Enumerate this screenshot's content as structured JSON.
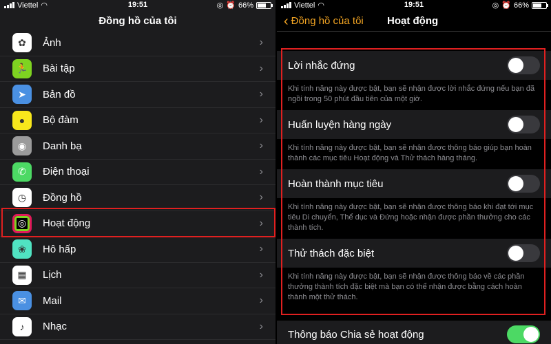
{
  "left": {
    "status": {
      "carrier": "Viettel",
      "time": "19:51",
      "battery": "66%",
      "battery_level": 0.66
    },
    "nav_title": "Đồng hồ của tôi",
    "items": [
      {
        "label": "Ảnh",
        "icon": "photos-icon",
        "color": "#ffffff"
      },
      {
        "label": "Bài tập",
        "icon": "workout-icon",
        "color": "#7ed321"
      },
      {
        "label": "Bản đồ",
        "icon": "maps-icon",
        "color": "#4a90e2"
      },
      {
        "label": "Bộ đàm",
        "icon": "walkie-talkie-icon",
        "color": "#f8e71c"
      },
      {
        "label": "Danh bạ",
        "icon": "contacts-icon",
        "color": "#9b9b9b"
      },
      {
        "label": "Điện thoại",
        "icon": "phone-icon",
        "color": "#4cd964"
      },
      {
        "label": "Đồng hồ",
        "icon": "clock-icon",
        "color": "#ffffff"
      },
      {
        "label": "Hoạt động",
        "icon": "activity-icon",
        "color": "#000000"
      },
      {
        "label": "Hô hấp",
        "icon": "breathe-icon",
        "color": "#50e3c2"
      },
      {
        "label": "Lịch",
        "icon": "calendar-icon",
        "color": "#ffffff"
      },
      {
        "label": "Mail",
        "icon": "mail-icon",
        "color": "#4a90e2"
      },
      {
        "label": "Nhạc",
        "icon": "music-icon",
        "color": "#ffffff"
      }
    ]
  },
  "right": {
    "status": {
      "carrier": "Viettel",
      "time": "19:51",
      "battery": "66%",
      "battery_level": 0.66
    },
    "back_label": "Đồng hồ của tôi",
    "nav_title": "Hoạt động",
    "settings": [
      {
        "label": "Lời nhắc đứng",
        "on": false,
        "desc": "Khi tính năng này được bật, bạn sẽ nhận được lời nhắc đứng nếu bạn đã ngồi trong 50 phút đầu tiên của một giờ."
      },
      {
        "label": "Huấn luyện hàng ngày",
        "on": false,
        "desc": "Khi tính năng này được bật, bạn sẽ nhận được thông báo giúp bạn hoàn thành các mục tiêu Hoạt động và Thử thách hàng tháng."
      },
      {
        "label": "Hoàn thành mục tiêu",
        "on": false,
        "desc": "Khi tính năng này được bật, bạn sẽ nhận được thông báo khi đạt tới mục tiêu Di chuyển, Thể dục và Đứng hoặc nhận được phần thưởng cho các thành tích."
      },
      {
        "label": "Thử thách đặc biệt",
        "on": false,
        "desc": "Khi tính năng này được bật, bạn sẽ nhận được thông báo về các phần thưởng thành tích đặc biệt mà bạn có thể nhận được bằng cách hoàn thành một thử thách."
      }
    ],
    "bottom": {
      "label": "Thông báo Chia sẻ hoạt động",
      "on": true
    }
  },
  "colors": {
    "accent": "#f5a623",
    "highlight": "#e02020",
    "toggle_on": "#4cd964"
  }
}
